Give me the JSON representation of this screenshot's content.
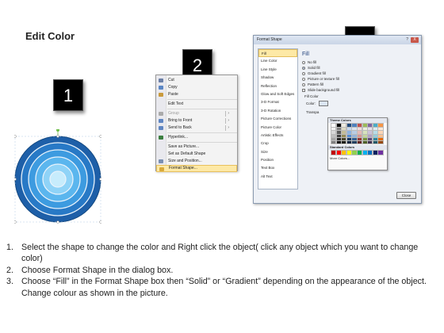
{
  "title": "Edit Color",
  "badges": [
    "1",
    "2",
    "3"
  ],
  "context_menu": {
    "items": [
      {
        "label": "Cut",
        "icon": "scissors-icon",
        "color": "#6b7fa6",
        "enabled": true
      },
      {
        "label": "Copy",
        "icon": "copy-icon",
        "color": "#5a86c4",
        "enabled": true
      },
      {
        "label": "Paste",
        "icon": "paste-icon",
        "color": "#c99a3c",
        "enabled": true
      },
      {
        "label": "Edit Text",
        "icon": "",
        "color": "",
        "enabled": true
      },
      {
        "label": "Group",
        "icon": "group-icon",
        "color": "#aaaaaa",
        "enabled": false,
        "submenu": true
      },
      {
        "label": "Bring to Front",
        "icon": "bring-to-front-icon",
        "color": "#5f86c2",
        "enabled": true,
        "submenu": true
      },
      {
        "label": "Send to Back",
        "icon": "send-to-back-icon",
        "color": "#5f86c2",
        "enabled": true,
        "submenu": true
      },
      {
        "label": "Hyperlink...",
        "icon": "hyperlink-icon",
        "color": "#3b7f3f",
        "enabled": true
      },
      {
        "label": "Save as Picture...",
        "icon": "",
        "color": "",
        "enabled": true
      },
      {
        "label": "Set as Default Shape",
        "icon": "",
        "color": "",
        "enabled": true
      },
      {
        "label": "Size and Position...",
        "icon": "size-icon",
        "color": "#7a8fb2",
        "enabled": true
      },
      {
        "label": "Format Shape...",
        "icon": "format-shape-icon",
        "color": "#d9a93a",
        "enabled": true,
        "highlighted": true
      }
    ]
  },
  "dialog": {
    "title": "Format Shape",
    "help": "?",
    "close_x": "X",
    "categories": [
      "Fill",
      "Line Color",
      "Line Style",
      "Shadow",
      "Reflection",
      "Glow and Soft Edges",
      "3-D Format",
      "3-D Rotation",
      "Picture Corrections",
      "Picture Color",
      "Artistic Effects",
      "Crop",
      "Size",
      "Position",
      "Text Box",
      "Alt Text"
    ],
    "selected_category": "Fill",
    "fill_heading": "Fill",
    "options": [
      {
        "label": "No fill",
        "selected": false
      },
      {
        "label": "Solid fill",
        "selected": true
      },
      {
        "label": "Gradient fill",
        "selected": false
      },
      {
        "label": "Picture or texture fill",
        "selected": false
      },
      {
        "label": "Pattern fill",
        "selected": false
      }
    ],
    "slide_bg": "Slide background fill",
    "fill_color_heading": "Fill Color",
    "color_label": "Color:",
    "transparency_label": "Transpa",
    "close_button": "Close"
  },
  "color_popup": {
    "theme_heading": "Theme Colors",
    "theme_top": [
      "#ffffff",
      "#000000",
      "#eeece1",
      "#1f497d",
      "#4f81bd",
      "#c0504d",
      "#9bbb59",
      "#8064a2",
      "#4bacc6",
      "#f79646"
    ],
    "theme_shades": [
      [
        "#f2f2f2",
        "#7f7f7f",
        "#ddd9c3",
        "#c6d9f0",
        "#dbe5f1",
        "#f2dcdb",
        "#ebf1dd",
        "#e5e0ec",
        "#dbeef3",
        "#fdeada"
      ],
      [
        "#d8d8d8",
        "#595959",
        "#c4bd97",
        "#8db3e2",
        "#b8cce4",
        "#e5b9b7",
        "#d7e3bc",
        "#ccc1d9",
        "#b7dde8",
        "#fbd5b5"
      ],
      [
        "#bfbfbf",
        "#3f3f3f",
        "#938953",
        "#548dd4",
        "#95b3d7",
        "#d99694",
        "#c3d69b",
        "#b2a2c7",
        "#92cddc",
        "#fac08f"
      ],
      [
        "#a5a5a5",
        "#262626",
        "#494429",
        "#17365d",
        "#366092",
        "#953734",
        "#76923c",
        "#5f497a",
        "#31859b",
        "#e36c09"
      ],
      [
        "#7f7f7f",
        "#0c0c0c",
        "#1d1b10",
        "#0f243e",
        "#244061",
        "#632423",
        "#4f6128",
        "#3f3151",
        "#205867",
        "#974806"
      ]
    ],
    "standard_heading": "Standard Colors",
    "standard": [
      "#c00000",
      "#ff0000",
      "#ffc000",
      "#ffff00",
      "#92d050",
      "#00b050",
      "#00b0f0",
      "#0070c0",
      "#002060",
      "#7030a0"
    ],
    "more_colors": "More Colors..."
  },
  "instructions": [
    {
      "num": "1.",
      "text": "Select the shape to change the color and Right click the object( click any object which you want to change color)"
    },
    {
      "num": "2.",
      "text": "Choose Format Shape in the dialog box."
    },
    {
      "num": "3.",
      "text": "Choose “Fill” in the Format Shape box then “Solid” or “Gradient” depending on the appearance of the object. Change colour as shown in the picture."
    }
  ]
}
